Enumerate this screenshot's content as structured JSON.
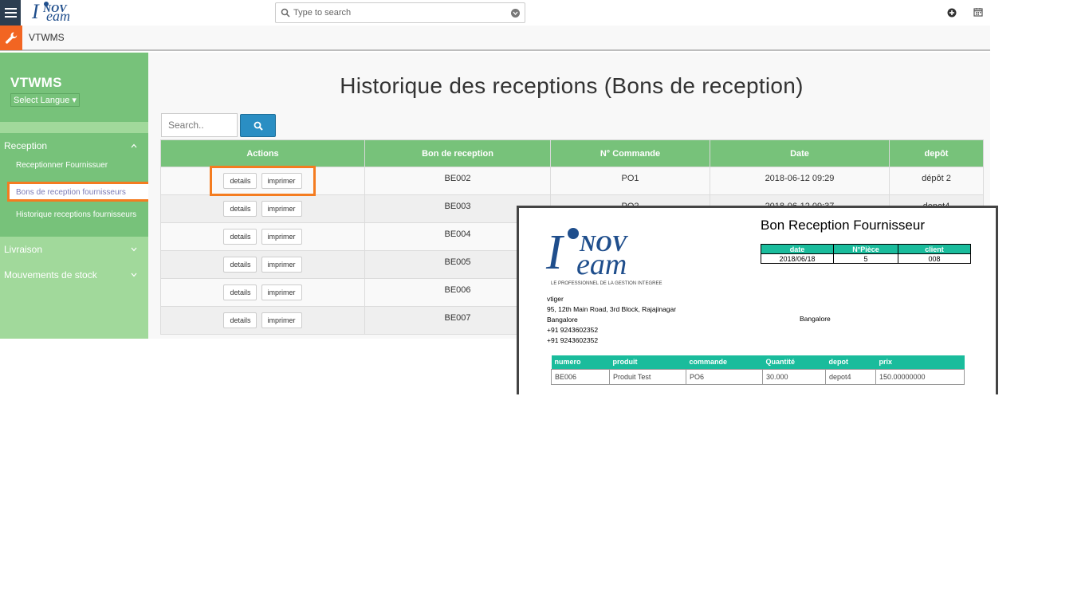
{
  "topbar": {
    "search_placeholder": "Type to search"
  },
  "subbar": {
    "app_name": "VTWMS"
  },
  "sidebar": {
    "title": "VTWMS",
    "language_label": "Select Langue",
    "sections": [
      {
        "label": "Reception",
        "items": [
          "Receptionner Fournissuer",
          "Bons de reception fournisseurs",
          "Historique receptions fournisseurs"
        ]
      },
      {
        "label": "Livraison"
      },
      {
        "label": "Mouvements de stock"
      }
    ]
  },
  "main": {
    "title": "Historique des receptions (Bons de reception)",
    "search_placeholder": "Search..",
    "columns": [
      "Actions",
      "Bon de reception",
      "N° Commande",
      "Date",
      "depôt"
    ],
    "actions": {
      "details": "details",
      "print": "imprimer"
    },
    "rows": [
      {
        "bon": "BE002",
        "commande": "PO1",
        "date": "2018-06-12 09:29",
        "depot": "dépôt 2"
      },
      {
        "bon": "BE003",
        "commande": "PO2",
        "date": "2018-06-12 09:37",
        "depot": "depot4"
      },
      {
        "bon": "BE004",
        "commande": "",
        "date": "",
        "depot": ""
      },
      {
        "bon": "BE005",
        "commande": "",
        "date": "",
        "depot": ""
      },
      {
        "bon": "BE006",
        "commande": "",
        "date": "",
        "depot": ""
      },
      {
        "bon": "BE007",
        "commande": "",
        "date": "",
        "depot": ""
      }
    ]
  },
  "document": {
    "title": "Bon Reception Fournisseur",
    "logo_text": "INOVTEAM",
    "logo_tagline": "LE PROFESSIONNEL DE LA GESTION INTEGREE",
    "meta_headers": [
      "date",
      "N°Pièce",
      "client"
    ],
    "meta_values": [
      "2018/06/18",
      "5",
      "008"
    ],
    "address_lines": [
      "vtiger",
      "95, 12th Main Road, 3rd Block, Rajajinagar",
      "Bangalore",
      "+91 9243602352",
      "+91 9243602352"
    ],
    "address_city2": "Bangalore",
    "line_headers": [
      "numero",
      "produit",
      "commande",
      "Quantité",
      "depot",
      "prix"
    ],
    "line_rows": [
      [
        "BE006",
        "Produit Test",
        "PO6",
        "30.000",
        "depot4",
        "150.00000000"
      ]
    ]
  },
  "colors": {
    "sidebar_dark": "#77c27a",
    "sidebar_light": "#a1d99b",
    "highlight": "#f47c20",
    "search_button": "#2a8ec3",
    "doc_teal": "#1abc9c"
  }
}
